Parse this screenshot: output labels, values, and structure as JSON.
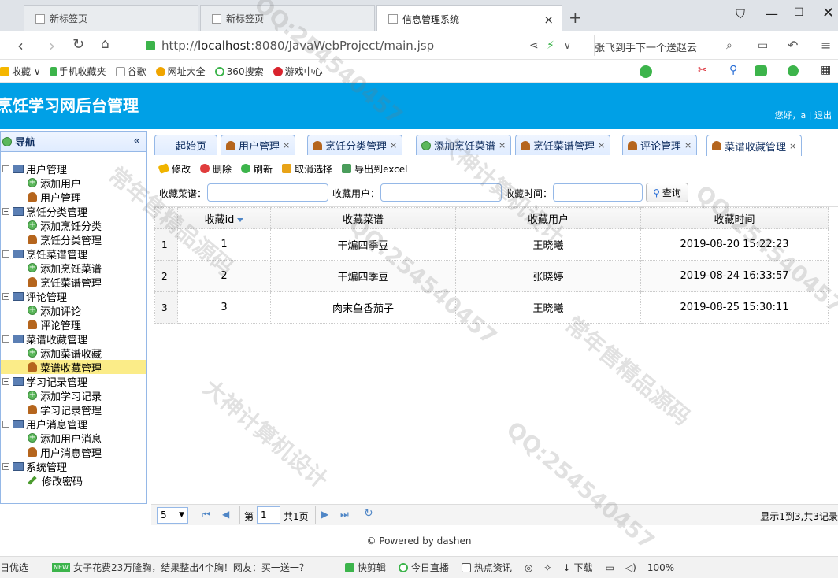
{
  "browser": {
    "tabs": [
      {
        "label": "新标签页",
        "active": false
      },
      {
        "label": "新标签页",
        "active": false
      },
      {
        "label": "信息管理系统",
        "active": true
      }
    ],
    "url_prefix": "http://",
    "url_host": "localhost",
    "url_rest": ":8080/JavaWebProject/main.jsp",
    "hot_search": "张飞到手下一个送赵云",
    "bookmarks": [
      "收藏",
      "手机收藏夹",
      "谷歌",
      "网址大全",
      "360搜索",
      "游戏中心"
    ]
  },
  "app": {
    "title": "烹饪学习网后台管理",
    "greeting": "您好，a | 退出"
  },
  "nav": {
    "title": "导航",
    "tree": [
      {
        "label": "用户管理",
        "type": "group"
      },
      {
        "label": "添加用户",
        "type": "add"
      },
      {
        "label": "用户管理",
        "type": "user"
      },
      {
        "label": "烹饪分类管理",
        "type": "group"
      },
      {
        "label": "添加烹饪分类",
        "type": "add"
      },
      {
        "label": "烹饪分类管理",
        "type": "user"
      },
      {
        "label": "烹饪菜谱管理",
        "type": "group"
      },
      {
        "label": "添加烹饪菜谱",
        "type": "add"
      },
      {
        "label": "烹饪菜谱管理",
        "type": "user"
      },
      {
        "label": "评论管理",
        "type": "group"
      },
      {
        "label": "添加评论",
        "type": "add"
      },
      {
        "label": "评论管理",
        "type": "user"
      },
      {
        "label": "菜谱收藏管理",
        "type": "group"
      },
      {
        "label": "添加菜谱收藏",
        "type": "add"
      },
      {
        "label": "菜谱收藏管理",
        "type": "user",
        "selected": true
      },
      {
        "label": "学习记录管理",
        "type": "group"
      },
      {
        "label": "添加学习记录",
        "type": "add"
      },
      {
        "label": "学习记录管理",
        "type": "user"
      },
      {
        "label": "用户消息管理",
        "type": "group"
      },
      {
        "label": "添加用户消息",
        "type": "add"
      },
      {
        "label": "用户消息管理",
        "type": "user"
      },
      {
        "label": "系统管理",
        "type": "group"
      },
      {
        "label": "修改密码",
        "type": "pencil"
      }
    ]
  },
  "tabs": [
    {
      "label": "起始页",
      "icon": "none",
      "closable": false
    },
    {
      "label": "用户管理",
      "icon": "user",
      "closable": true
    },
    {
      "label": "烹饪分类管理",
      "icon": "user",
      "closable": true
    },
    {
      "label": "添加烹饪菜谱",
      "icon": "add",
      "closable": true
    },
    {
      "label": "烹饪菜谱管理",
      "icon": "user",
      "closable": true
    },
    {
      "label": "评论管理",
      "icon": "user",
      "closable": true
    },
    {
      "label": "菜谱收藏管理",
      "icon": "user",
      "closable": true,
      "active": true
    }
  ],
  "toolbar": {
    "edit": "修改",
    "delete": "删除",
    "refresh": "刷新",
    "deselect": "取消选择",
    "export": "导出到excel"
  },
  "search": {
    "recipe_label": "收藏菜谱：",
    "user_label": "收藏用户：",
    "time_label": "收藏时间：",
    "button": "查询"
  },
  "grid": {
    "columns": [
      "收藏id",
      "收藏菜谱",
      "收藏用户",
      "收藏时间"
    ],
    "rows": [
      {
        "n": "1",
        "id": "1",
        "recipe": "干煸四季豆",
        "user": "王晓曦",
        "time": "2019-08-20 15:22:23"
      },
      {
        "n": "2",
        "id": "2",
        "recipe": "干煸四季豆",
        "user": "张晓婷",
        "time": "2019-08-24 16:33:57"
      },
      {
        "n": "3",
        "id": "3",
        "recipe": "肉末鱼香茄子",
        "user": "王晓曦",
        "time": "2019-08-25 15:30:11"
      }
    ]
  },
  "pager": {
    "page_size": "5",
    "page_prefix": "第",
    "page_value": "1",
    "page_suffix": "共1页",
    "info": "显示1到3,共3记录"
  },
  "footer": "© Powered by dashen",
  "statusbar": {
    "items": [
      "日优选",
      "女子花费23万隆胸，结果整出4个胸！网友：买一送一？",
      "快剪辑",
      "今日直播",
      "热点资讯",
      "下载",
      "100%"
    ],
    "new_badge": "NEW"
  },
  "watermarks": [
    "QQ:254540457",
    "大神计算机设计",
    "常年售精品源码"
  ]
}
